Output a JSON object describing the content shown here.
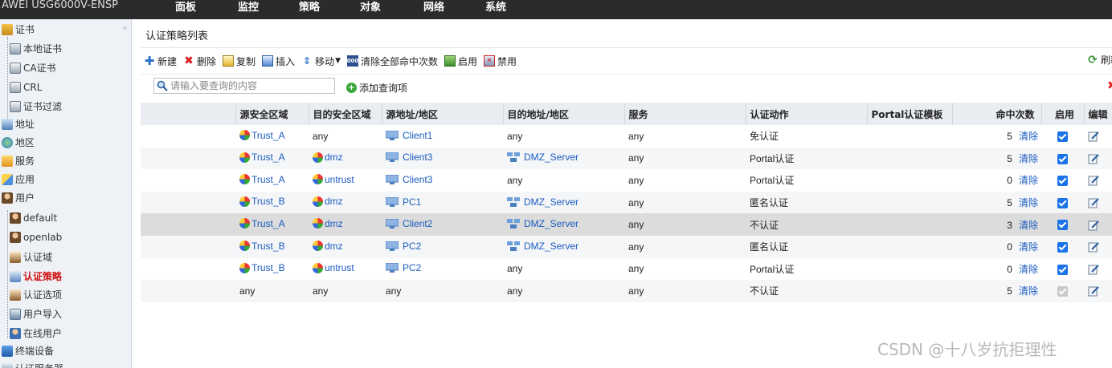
{
  "topbar": {
    "brand": "AWEI   USG6000V-ENSP",
    "nav": [
      "面板",
      "监控",
      "策略",
      "对象",
      "网络",
      "系统"
    ]
  },
  "sidebar": {
    "items": [
      {
        "label": "证书"
      },
      {
        "label": "本地证书"
      },
      {
        "label": "CA证书"
      },
      {
        "label": "CRL"
      },
      {
        "label": "证书过滤"
      },
      {
        "label": "地址"
      },
      {
        "label": "地区"
      },
      {
        "label": "服务"
      },
      {
        "label": "应用"
      },
      {
        "label": "用户"
      },
      {
        "label": "default"
      },
      {
        "label": "openlab"
      },
      {
        "label": "认证域"
      },
      {
        "label": "认证策略"
      },
      {
        "label": "认证选项"
      },
      {
        "label": "用户导入"
      },
      {
        "label": "在线用户"
      },
      {
        "label": "终端设备"
      },
      {
        "label": "认证服务器"
      }
    ]
  },
  "main": {
    "title": "认证策略列表",
    "toolbar": {
      "new": "新建",
      "delete": "删除",
      "copy": "复制",
      "insert": "插入",
      "move": "移动",
      "clear_hits": "清除全部命中次数",
      "enable": "启用",
      "disable": "禁用",
      "refresh": "刷新"
    },
    "search": {
      "placeholder": "请输入要查询的内容",
      "add_query": "添加查询项"
    },
    "columns": [
      "源安全区域",
      "目的安全区域",
      "源地址/地区",
      "目的地址/地区",
      "服务",
      "认证动作",
      "Portal认证模板",
      "命中次数",
      "启用",
      "编辑"
    ],
    "rows": [
      {
        "src_zone": "Trust_A",
        "dst_zone": "any",
        "src_addr": "Client1",
        "dst_addr": "any",
        "service": "any",
        "action": "免认证",
        "portal": "",
        "hits": "5",
        "clear": "清除",
        "enabled": true
      },
      {
        "src_zone": "Trust_A",
        "dst_zone": "dmz",
        "src_addr": "Client3",
        "dst_addr": "DMZ_Server",
        "service": "any",
        "action": "Portal认证",
        "portal": "",
        "hits": "5",
        "clear": "清除",
        "enabled": true
      },
      {
        "src_zone": "Trust_A",
        "dst_zone": "untrust",
        "src_addr": "Client3",
        "dst_addr": "any",
        "service": "any",
        "action": "Portal认证",
        "portal": "",
        "hits": "0",
        "clear": "清除",
        "enabled": true
      },
      {
        "src_zone": "Trust_B",
        "dst_zone": "dmz",
        "src_addr": "PC1",
        "dst_addr": "DMZ_Server",
        "service": "any",
        "action": "匿名认证",
        "portal": "",
        "hits": "5",
        "clear": "清除",
        "enabled": true
      },
      {
        "src_zone": "Trust_A",
        "dst_zone": "dmz",
        "src_addr": "Client2",
        "dst_addr": "DMZ_Server",
        "service": "any",
        "action": "不认证",
        "portal": "",
        "hits": "3",
        "clear": "清除",
        "enabled": true
      },
      {
        "src_zone": "Trust_B",
        "dst_zone": "dmz",
        "src_addr": "PC2",
        "dst_addr": "DMZ_Server",
        "service": "any",
        "action": "匿名认证",
        "portal": "",
        "hits": "0",
        "clear": "清除",
        "enabled": true
      },
      {
        "src_zone": "Trust_B",
        "dst_zone": "untrust",
        "src_addr": "PC2",
        "dst_addr": "any",
        "service": "any",
        "action": "Portal认证",
        "portal": "",
        "hits": "0",
        "clear": "清除",
        "enabled": true
      },
      {
        "src_zone": "any",
        "dst_zone": "any",
        "src_addr": "any",
        "dst_addr": "any",
        "service": "any",
        "action": "不认证",
        "portal": "",
        "hits": "5",
        "clear": "清除",
        "enabled": false
      }
    ]
  },
  "watermark": "CSDN @十八岁抗拒理性",
  "colors": {
    "link": "#1a5bbf",
    "topbar": "#2b2b2b",
    "sidebar": "#eef2f6",
    "active": "#d01010",
    "checkbox": "#1a73e8"
  }
}
